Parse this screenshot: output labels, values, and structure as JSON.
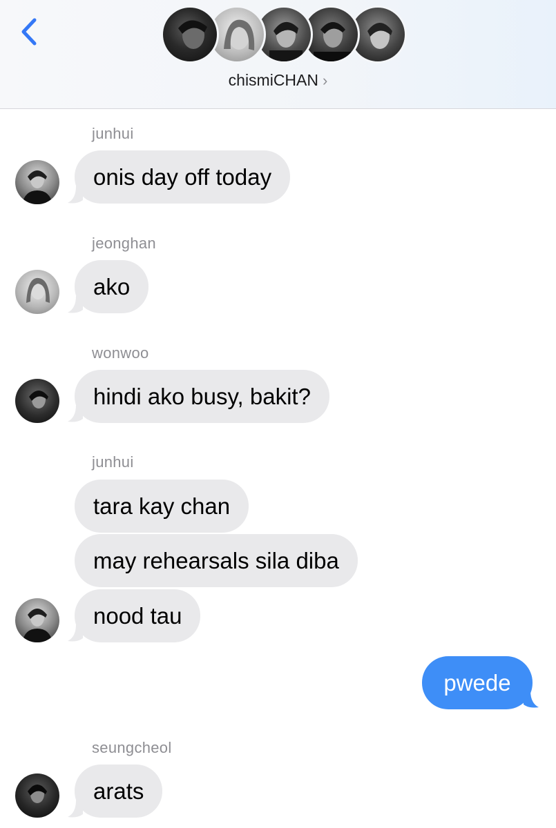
{
  "header": {
    "group_name": "chismiCHAN",
    "chevron": "›",
    "back_icon": "chevron-left-icon",
    "accent": "#3478f6",
    "participants": [
      {
        "icon": "member-avatar"
      },
      {
        "icon": "member-avatar"
      },
      {
        "icon": "member-avatar"
      },
      {
        "icon": "member-avatar"
      },
      {
        "icon": "member-avatar"
      }
    ]
  },
  "conversation": {
    "incoming_bubble_color": "#e9e9eb",
    "outgoing_bubble_color": "#3e8ef7",
    "groups": [
      {
        "sender": "junhui",
        "messages": [
          "onis day off today"
        ]
      },
      {
        "sender": "jeonghan",
        "messages": [
          "ako"
        ]
      },
      {
        "sender": "wonwoo",
        "messages": [
          "hindi ako busy, bakit?"
        ]
      },
      {
        "sender": "junhui",
        "messages": [
          "tara kay chan",
          "may rehearsals sila diba",
          "nood tau"
        ]
      },
      {
        "sender": "",
        "outgoing": true,
        "messages": [
          "pwede"
        ]
      },
      {
        "sender": "seungcheol",
        "messages": [
          "arats"
        ]
      }
    ]
  }
}
